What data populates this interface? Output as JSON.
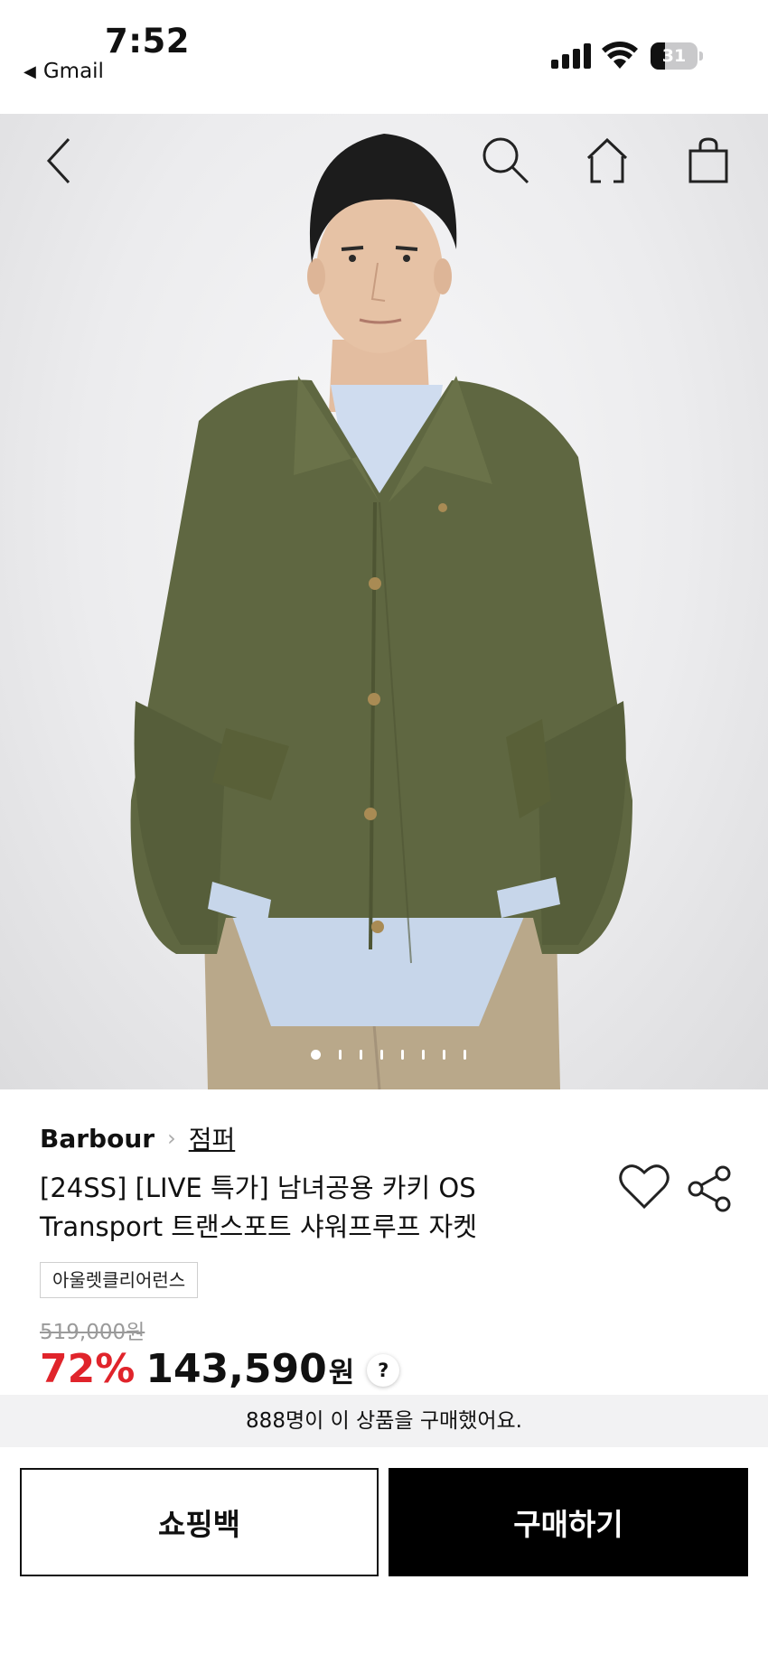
{
  "status_bar": {
    "time": "7:52",
    "back_app": "Gmail",
    "back_arrow": "◀",
    "battery_level": "31",
    "battery_fraction": 0.31
  },
  "hero": {
    "image_alt": "man wearing khaki jacket",
    "dot_count": 8,
    "active_dot": 0,
    "icons": [
      "back-icon",
      "search-icon",
      "home-icon",
      "shopping-bag-icon"
    ]
  },
  "product": {
    "brand": "Barbour",
    "breadcrumb_sep": "›",
    "category": "점퍼",
    "title_line1": "[24SS] [LIVE 특가] 남녀공용 카키 OS",
    "title_line2": "Transport 트랜스포트 샤워프루프 자켓",
    "tag": "아울렛클리어런스",
    "original_price": "519,000원",
    "discount": "72%",
    "price": "143,590",
    "price_unit": "원",
    "help": "?"
  },
  "purchase_banner": "888명이 이 상품을 구매했어요.",
  "actions": {
    "shopping_bag": "쇼핑백",
    "buy": "구매하기"
  },
  "colors": {
    "discount": "#e0242b",
    "buy_button": "#000000",
    "banner_bg": "#f2f2f3"
  }
}
